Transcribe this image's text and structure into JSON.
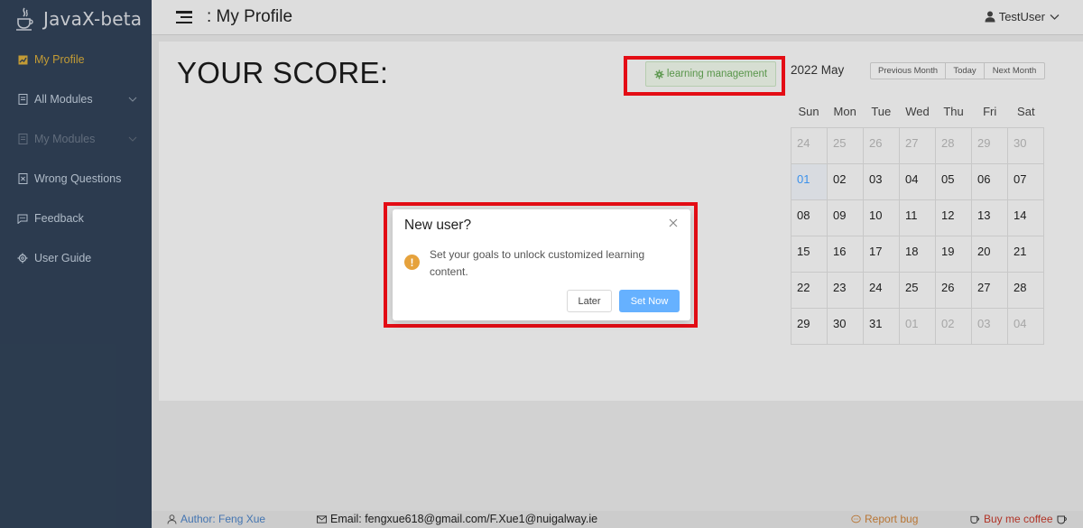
{
  "sidebar": {
    "logo_text": "JavaX-beta",
    "items": [
      {
        "label": "My Profile",
        "icon": "chart-icon",
        "state": "active"
      },
      {
        "label": "All Modules",
        "icon": "document-icon",
        "state": "normal",
        "has_submenu": true
      },
      {
        "label": "My Modules",
        "icon": "document-icon",
        "state": "disabled",
        "has_submenu": true
      },
      {
        "label": "Wrong Questions",
        "icon": "error-document-icon",
        "state": "normal"
      },
      {
        "label": "Feedback",
        "icon": "chat-icon",
        "state": "normal"
      },
      {
        "label": "User Guide",
        "icon": "settings-icon",
        "state": "normal"
      }
    ]
  },
  "header": {
    "title": ": My Profile",
    "user_name": "TestUser"
  },
  "main": {
    "score_title": "YOUR SCORE:",
    "learning_button": "learning management"
  },
  "calendar": {
    "title": "2022 May",
    "buttons": [
      "Previous Month",
      "Today",
      "Next Month"
    ],
    "weekdays": [
      "Sun",
      "Mon",
      "Tue",
      "Wed",
      "Thu",
      "Fri",
      "Sat"
    ],
    "weeks": [
      [
        {
          "d": "24",
          "t": "other"
        },
        {
          "d": "25",
          "t": "other"
        },
        {
          "d": "26",
          "t": "other"
        },
        {
          "d": "27",
          "t": "other"
        },
        {
          "d": "28",
          "t": "other"
        },
        {
          "d": "29",
          "t": "other"
        },
        {
          "d": "30",
          "t": "other"
        }
      ],
      [
        {
          "d": "01",
          "t": "today"
        },
        {
          "d": "02",
          "t": "cur"
        },
        {
          "d": "03",
          "t": "cur"
        },
        {
          "d": "04",
          "t": "cur"
        },
        {
          "d": "05",
          "t": "cur"
        },
        {
          "d": "06",
          "t": "cur"
        },
        {
          "d": "07",
          "t": "cur"
        }
      ],
      [
        {
          "d": "08",
          "t": "cur"
        },
        {
          "d": "09",
          "t": "cur"
        },
        {
          "d": "10",
          "t": "cur"
        },
        {
          "d": "11",
          "t": "cur"
        },
        {
          "d": "12",
          "t": "cur"
        },
        {
          "d": "13",
          "t": "cur"
        },
        {
          "d": "14",
          "t": "cur"
        }
      ],
      [
        {
          "d": "15",
          "t": "cur"
        },
        {
          "d": "16",
          "t": "cur"
        },
        {
          "d": "17",
          "t": "cur"
        },
        {
          "d": "18",
          "t": "cur"
        },
        {
          "d": "19",
          "t": "cur"
        },
        {
          "d": "20",
          "t": "cur"
        },
        {
          "d": "21",
          "t": "cur"
        }
      ],
      [
        {
          "d": "22",
          "t": "cur"
        },
        {
          "d": "23",
          "t": "cur"
        },
        {
          "d": "24",
          "t": "cur"
        },
        {
          "d": "25",
          "t": "cur"
        },
        {
          "d": "26",
          "t": "cur"
        },
        {
          "d": "27",
          "t": "cur"
        },
        {
          "d": "28",
          "t": "cur"
        }
      ],
      [
        {
          "d": "29",
          "t": "cur"
        },
        {
          "d": "30",
          "t": "cur"
        },
        {
          "d": "31",
          "t": "cur"
        },
        {
          "d": "01",
          "t": "other"
        },
        {
          "d": "02",
          "t": "other"
        },
        {
          "d": "03",
          "t": "other"
        },
        {
          "d": "04",
          "t": "other"
        }
      ]
    ]
  },
  "dialog": {
    "title": "New user?",
    "message": "Set your goals to unlock customized learning content.",
    "later_label": "Later",
    "setnow_label": "Set Now"
  },
  "footer": {
    "author": "Author: Feng Xue",
    "email": "Email: fengxue618@gmail.com/F.Xue1@nuigalway.ie",
    "report_bug": "Report bug",
    "buy_coffee": "Buy me coffee"
  },
  "colors": {
    "sidebar_bg": "#304156",
    "active_menu": "#d4a93a",
    "primary": "#66b1ff",
    "highlight_box": "#e40d15",
    "success_text": "#61a352",
    "warning": "#e6a23c"
  }
}
